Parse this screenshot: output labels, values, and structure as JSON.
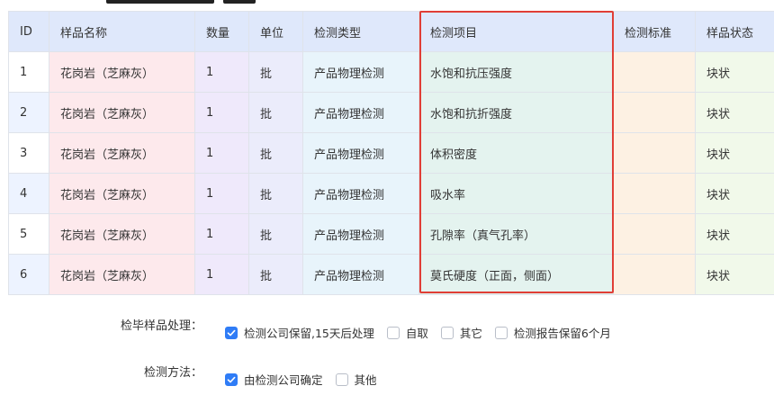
{
  "table": {
    "headers": {
      "id": "ID",
      "name": "样品名称",
      "qty": "数量",
      "unit": "单位",
      "type": "检测类型",
      "item": "检测项目",
      "std": "检测标准",
      "state": "样品状态"
    },
    "rows": [
      {
        "id": "1",
        "name": "花岗岩（芝麻灰）",
        "qty": "1",
        "unit": "批",
        "type": "产品物理检测",
        "item": "水饱和抗压强度",
        "std": "",
        "state": "块状"
      },
      {
        "id": "2",
        "name": "花岗岩（芝麻灰）",
        "qty": "1",
        "unit": "批",
        "type": "产品物理检测",
        "item": "水饱和抗折强度",
        "std": "",
        "state": "块状"
      },
      {
        "id": "3",
        "name": "花岗岩（芝麻灰）",
        "qty": "1",
        "unit": "批",
        "type": "产品物理检测",
        "item": "体积密度",
        "std": "",
        "state": "块状"
      },
      {
        "id": "4",
        "name": "花岗岩（芝麻灰）",
        "qty": "1",
        "unit": "批",
        "type": "产品物理检测",
        "item": "吸水率",
        "std": "",
        "state": "块状"
      },
      {
        "id": "5",
        "name": "花岗岩（芝麻灰）",
        "qty": "1",
        "unit": "批",
        "type": "产品物理检测",
        "item": "孔隙率（真气孔率）",
        "std": "",
        "state": "块状"
      },
      {
        "id": "6",
        "name": "花岗岩（芝麻灰）",
        "qty": "1",
        "unit": "批",
        "type": "产品物理检测",
        "item": "莫氏硬度（正面，侧面）",
        "std": "",
        "state": "块状"
      }
    ]
  },
  "sample_handling": {
    "label": "检毕样品处理：",
    "options": [
      {
        "label": "检测公司保留,15天后处理",
        "checked": true
      },
      {
        "label": "自取",
        "checked": false
      },
      {
        "label": "其它",
        "checked": false
      },
      {
        "label": "检测报告保留6个月",
        "checked": false
      }
    ]
  },
  "test_method": {
    "label": "检测方法：",
    "options": [
      {
        "label": "由检测公司确定",
        "checked": true
      },
      {
        "label": "其他",
        "checked": false
      }
    ]
  },
  "colors": {
    "accent": "#2f7cf6",
    "highlight": "#e03e36",
    "header_bg": "#dfe8fb"
  }
}
